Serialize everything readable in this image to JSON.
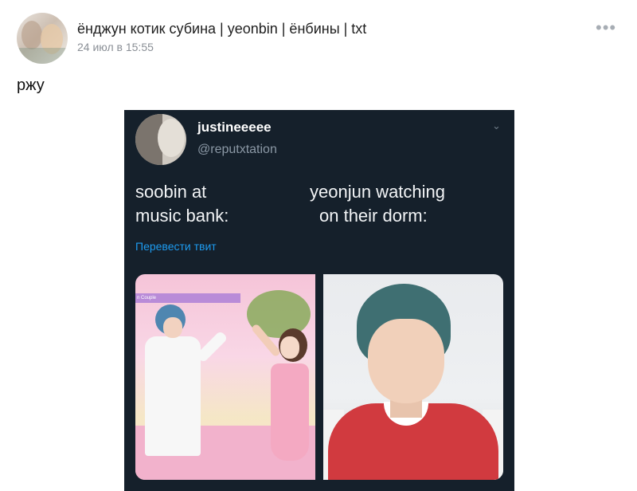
{
  "post": {
    "author": "ёнджун котик субина | yeonbin | ёнбины | txt",
    "date": "24 июл в 15:55",
    "more_icon": "•••",
    "text": "ржу"
  },
  "tweet": {
    "name": "justineeeee",
    "handle": "@reputxtation",
    "chevron": "⌄",
    "left_caption_line1": "soobin at",
    "left_caption_line2": "music bank:",
    "right_caption_line1": "yeonjun watching",
    "right_caption_line2": "on their dorm:",
    "translate_link": "Перевести твит",
    "banner_text": "n Couple"
  },
  "colors": {
    "tweet_background": "#15202b",
    "link_blue": "#1d9bf0",
    "muted_text": "#8b98a5"
  }
}
